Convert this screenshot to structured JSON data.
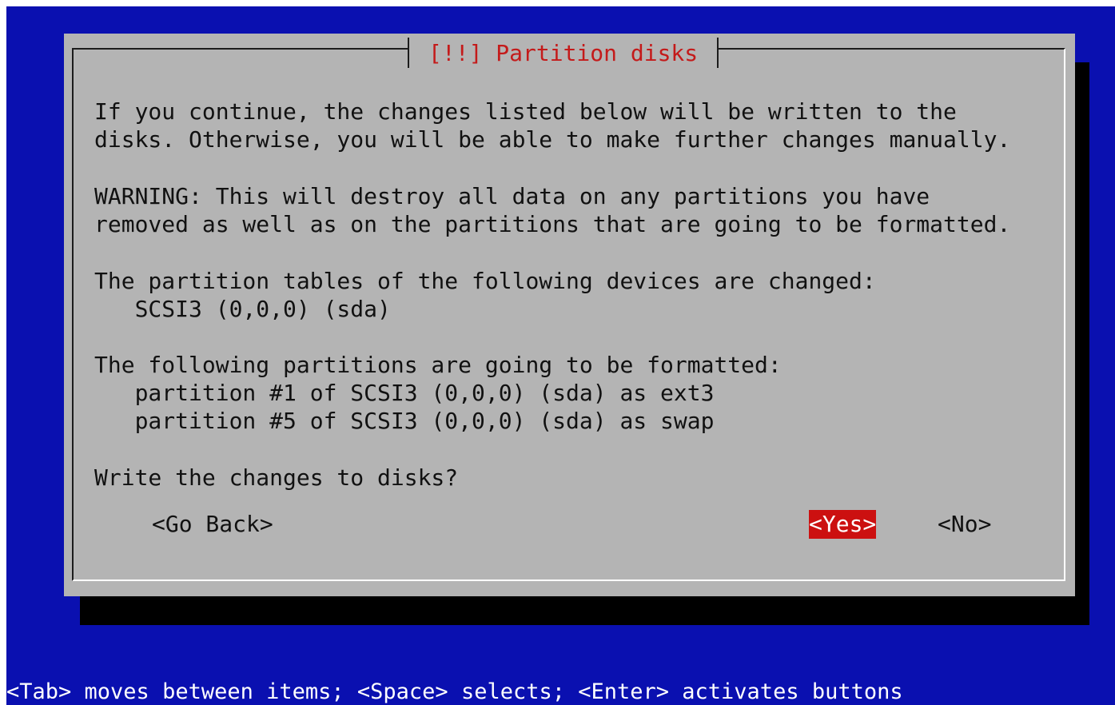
{
  "dialog": {
    "title": "[!!] Partition disks",
    "intro": [
      "If you continue, the changes listed below will be written to the",
      "disks. Otherwise, you will be able to make further changes manually."
    ],
    "warning": [
      "WARNING: This will destroy all data on any partitions you have",
      "removed as well as on the partitions that are going to be formatted."
    ],
    "tables_heading": "The partition tables of the following devices are changed:",
    "tables_devices": [
      "   SCSI3 (0,0,0) (sda)"
    ],
    "formatted_heading": "The following partitions are going to be formatted:",
    "formatted_partitions": [
      "   partition #1 of SCSI3 (0,0,0) (sda) as ext3",
      "   partition #5 of SCSI3 (0,0,0) (sda) as swap"
    ],
    "question": "Write the changes to disks?"
  },
  "buttons": {
    "go_back": "<Go Back>",
    "yes": "<Yes>",
    "no": "<No>",
    "selected": "yes"
  },
  "footer": {
    "help": "<Tab> moves between items; <Space> selects; <Enter> activates buttons"
  },
  "colors": {
    "background": "#0a10b0",
    "dialog": "#b4b4b4",
    "title": "#c41a1a",
    "selected_button": "#cc1010"
  }
}
